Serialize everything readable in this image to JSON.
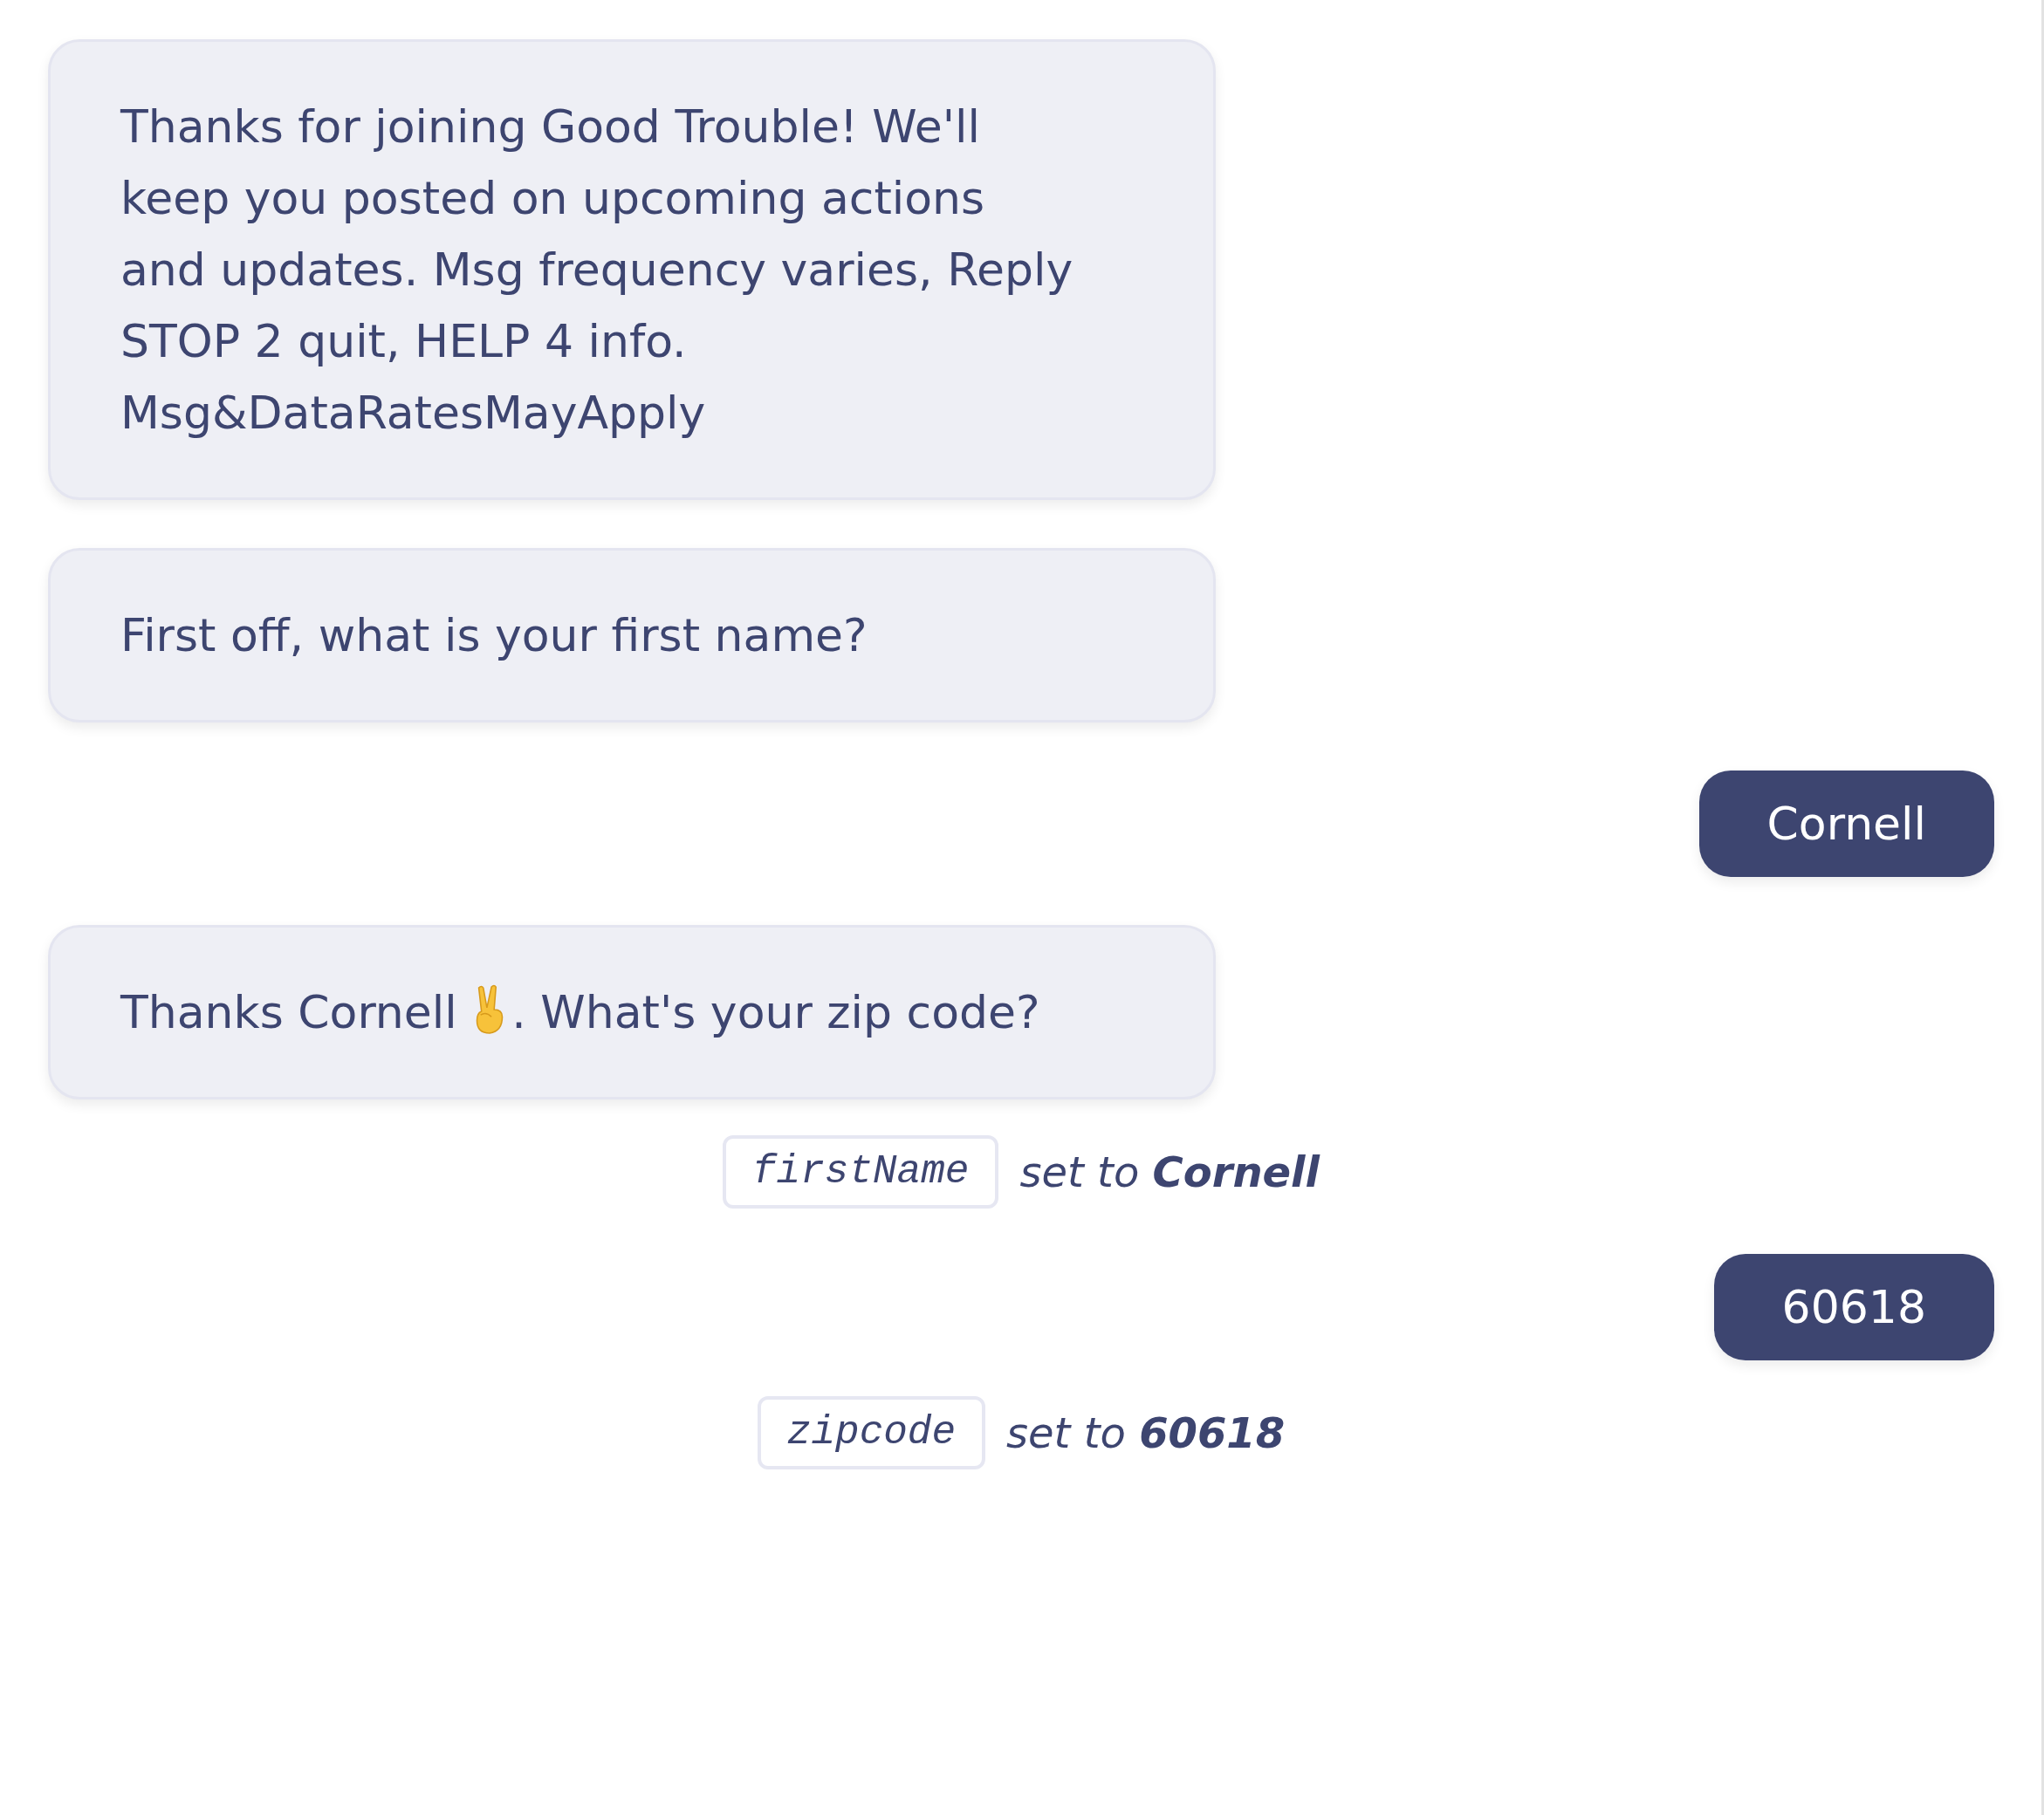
{
  "messages": [
    {
      "kind": "bot",
      "parts": [
        {
          "kind": "text",
          "text": "Thanks for joining Good Trouble! We'll keep you posted on upcoming actions and updates. Msg frequency varies, Reply STOP 2 quit, HELP 4 info. Msg&DataRatesMayApply"
        }
      ]
    },
    {
      "kind": "bot",
      "parts": [
        {
          "kind": "text",
          "text": "First off, what is your first name?"
        }
      ]
    },
    {
      "kind": "user",
      "parts": [
        {
          "kind": "text",
          "text": "Cornell"
        }
      ]
    },
    {
      "kind": "bot",
      "parts": [
        {
          "kind": "text",
          "text": "Thanks Cornell "
        },
        {
          "kind": "victory-hand"
        },
        {
          "kind": "text",
          "text": ". What's your zip code?"
        }
      ]
    },
    {
      "kind": "variable",
      "name": "firstName",
      "text": "set to **Cornell**"
    },
    {
      "kind": "user",
      "parts": [
        {
          "kind": "text",
          "text": "60618"
        }
      ]
    },
    {
      "kind": "variable",
      "name": "zipcode",
      "text": "set to **60618**"
    }
  ]
}
